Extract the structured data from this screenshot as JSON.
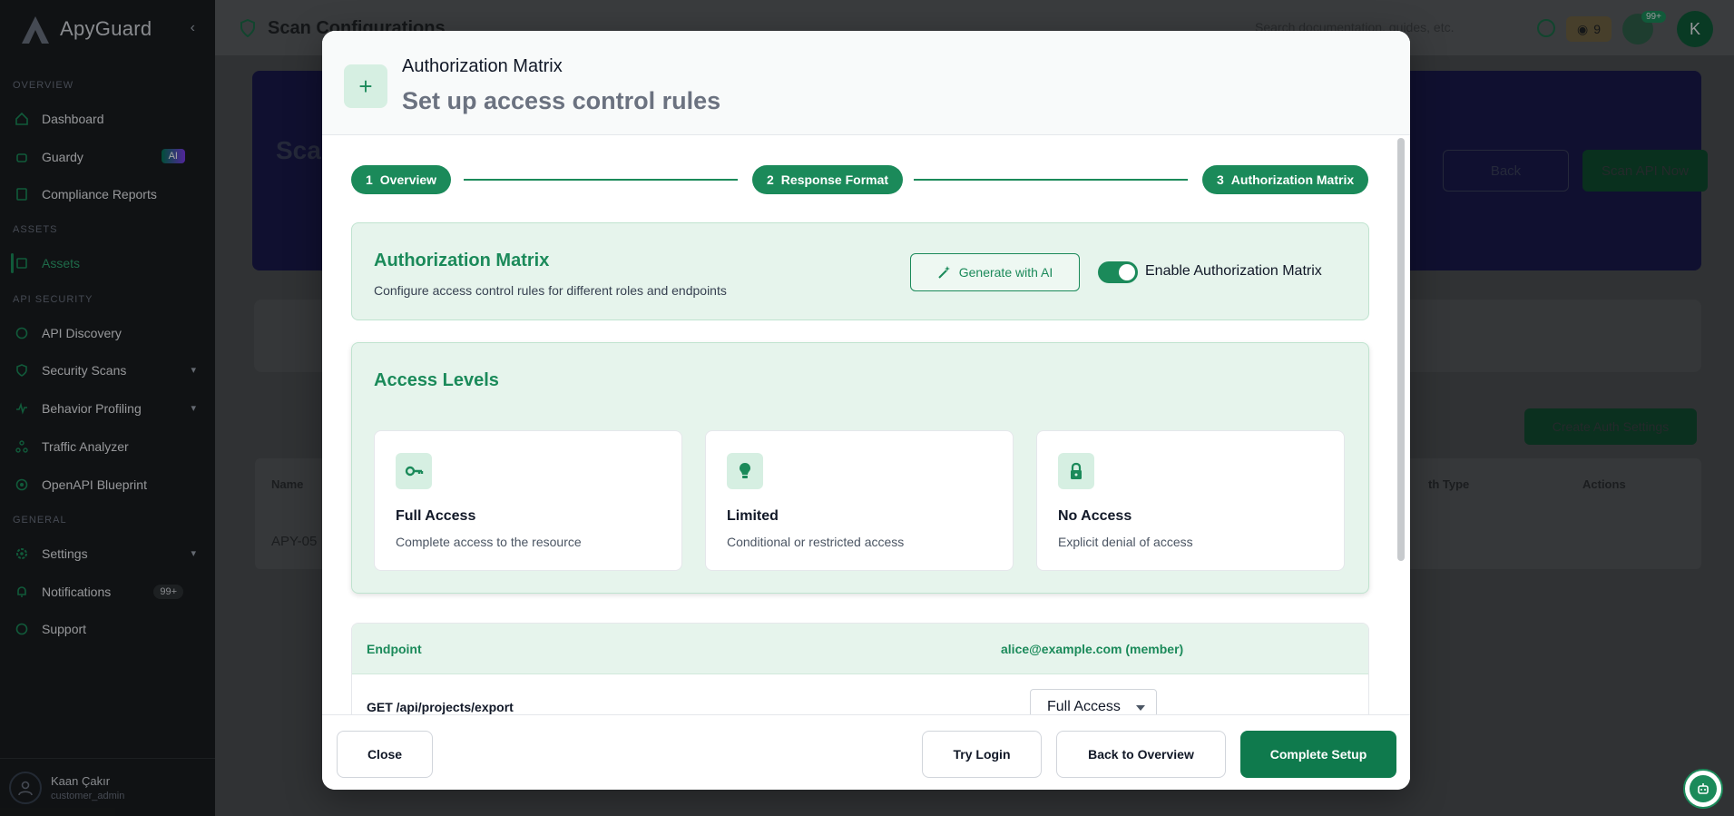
{
  "sidebar": {
    "logo": "ApyGuard",
    "sections": {
      "overview": "OVERVIEW",
      "assets": "ASSETS",
      "api_security": "API SECURITY",
      "general": "GENERAL"
    },
    "items": {
      "dashboard": "Dashboard",
      "guardy": "Guardy",
      "guardy_badge": "AI",
      "compliance": "Compliance Reports",
      "assets": "Assets",
      "api_discovery": "API Discovery",
      "security_scans": "Security Scans",
      "behavior_profiling": "Behavior Profiling",
      "traffic_analyzer": "Traffic Analyzer",
      "openapi_blueprint": "OpenAPI Blueprint",
      "settings": "Settings",
      "notifications": "Notifications",
      "notifications_badge": "99+",
      "support": "Support"
    },
    "user": {
      "name": "Kaan Çakır",
      "role": "customer_admin"
    }
  },
  "topbar": {
    "title": "Scan Configurations",
    "search_placeholder": "Search documentation, guides, etc.",
    "coins": "9",
    "bell_badge": "99+",
    "avatar_initial": "K"
  },
  "background": {
    "hero_title": "Sca",
    "back_label": "Back",
    "scan_label": "Scan API Now",
    "create_auth_label": "Create Auth Settings",
    "table_col_name": "Name",
    "table_col_auth_type": "th Type",
    "table_col_actions": "Actions",
    "row_name": "APY-05"
  },
  "modal": {
    "title": "Authorization Matrix",
    "subtitle": "Set up access control rules",
    "steps": [
      {
        "num": "1",
        "label": "Overview"
      },
      {
        "num": "2",
        "label": "Response Format"
      },
      {
        "num": "3",
        "label": "Authorization Matrix"
      }
    ],
    "auth_card": {
      "title": "Authorization Matrix",
      "description": "Configure access control rules for different roles and endpoints",
      "generate_label": "Generate with AI",
      "toggle_label": "Enable Authorization Matrix",
      "toggle_on": true
    },
    "access_levels": {
      "title": "Access Levels",
      "items": [
        {
          "name": "Full Access",
          "description": "Complete access to the resource",
          "icon": "key-icon"
        },
        {
          "name": "Limited",
          "description": "Conditional or restricted access",
          "icon": "lightbulb-icon"
        },
        {
          "name": "No Access",
          "description": "Explicit denial of access",
          "icon": "lock-icon"
        }
      ]
    },
    "endpoint_table": {
      "col_endpoint": "Endpoint",
      "col_user": "alice@example.com (member)",
      "rows": [
        {
          "endpoint": "GET /api/projects/export",
          "access": "Full Access"
        }
      ]
    },
    "footer": {
      "close": "Close",
      "try_login": "Try Login",
      "back": "Back to Overview",
      "complete": "Complete Setup"
    }
  },
  "colors": {
    "accent": "#1b8a5a",
    "accent_light": "#e6f4ec",
    "sidebar_bg": "#1a1d1f"
  }
}
